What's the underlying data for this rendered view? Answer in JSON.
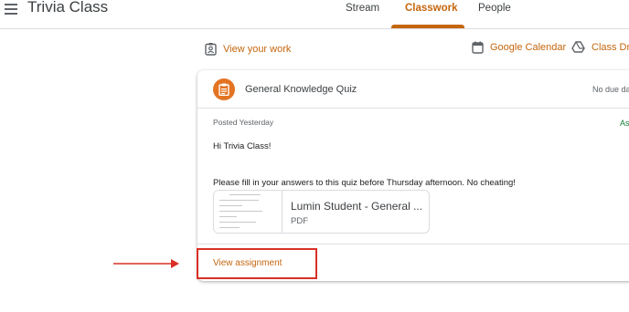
{
  "header": {
    "app_title": "Trivia Class",
    "tabs": [
      {
        "label": "Stream",
        "active": false
      },
      {
        "label": "Classwork",
        "active": true
      },
      {
        "label": "People",
        "active": false
      }
    ]
  },
  "toolbar": {
    "view_work": "View your work",
    "google_calendar": "Google Calendar",
    "class_drive": "Class Drive"
  },
  "assignment": {
    "title": "General Knowledge Quiz",
    "due": "No due date",
    "posted": "Posted Yesterday",
    "status_partial": "As",
    "greeting": "Hi Trivia Class!",
    "instructions": "Please fill in your answers to this quiz before Thursday afternoon. No cheating!",
    "attachment": {
      "title": "Lumin Student - General ...",
      "type": "PDF"
    },
    "view_link": "View assignment"
  },
  "colors": {
    "accent": "#c5660e",
    "assignment_icon_bg": "#e37423",
    "highlight": "#d93025"
  }
}
